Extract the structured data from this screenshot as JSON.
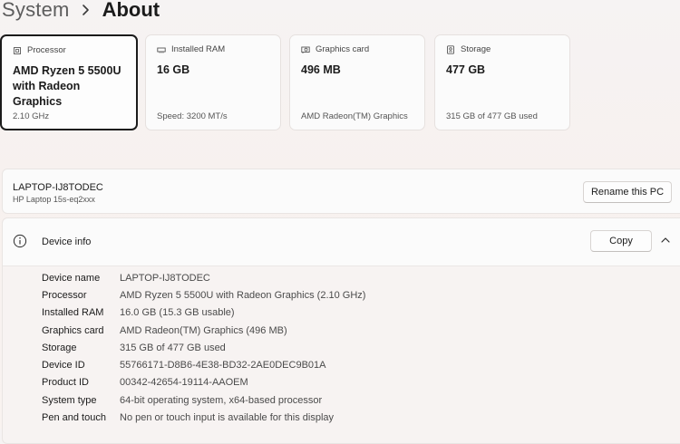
{
  "breadcrumb": {
    "parent": "System",
    "current": "About"
  },
  "cards": [
    {
      "icon": "processor-icon",
      "label": "Processor",
      "value": "AMD Ryzen 5 5500U with Radeon Graphics",
      "sub": "2.10 GHz",
      "selected": true
    },
    {
      "icon": "ram-icon",
      "label": "Installed RAM",
      "value": "16 GB",
      "sub": "Speed: 3200 MT/s"
    },
    {
      "icon": "graphics-card-icon",
      "label": "Graphics card",
      "value": "496 MB",
      "sub": "AMD Radeon(TM) Graphics"
    },
    {
      "icon": "storage-icon",
      "label": "Storage",
      "value": "477 GB",
      "sub": "315 GB of 477 GB used"
    }
  ],
  "pc": {
    "name": "LAPTOP-IJ8TODEC",
    "model": "HP Laptop 15s-eq2xxx",
    "rename_label": "Rename this PC"
  },
  "device_info": {
    "title": "Device info",
    "copy_label": "Copy",
    "rows": [
      {
        "label": "Device name",
        "value": "LAPTOP-IJ8TODEC"
      },
      {
        "label": "Processor",
        "value": "AMD Ryzen 5 5500U with Radeon Graphics (2.10 GHz)"
      },
      {
        "label": "Installed RAM",
        "value": "16.0 GB (15.3 GB usable)"
      },
      {
        "label": "Graphics card",
        "value": "AMD Radeon(TM) Graphics (496 MB)"
      },
      {
        "label": "Storage",
        "value": "315 GB of 477 GB used"
      },
      {
        "label": "Device ID",
        "value": "55766171-D8B6-4E38-BD32-2AE0DEC9B01A"
      },
      {
        "label": "Product ID",
        "value": "00342-42654-19114-AAOEM"
      },
      {
        "label": "System type",
        "value": "64-bit operating system, x64-based processor"
      },
      {
        "label": "Pen and touch",
        "value": "No pen or touch input is available for this display"
      }
    ]
  }
}
